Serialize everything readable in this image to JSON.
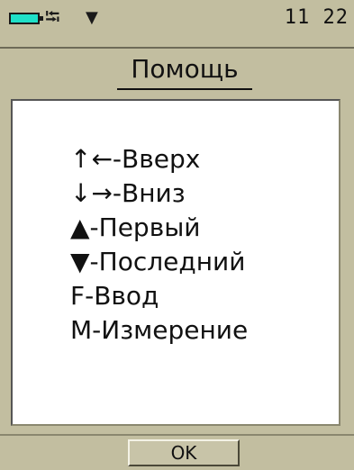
{
  "status_bar": {
    "battery_icon": "battery-icon",
    "battery_color": "#1fe0c8",
    "usb_icon": "usb-icon",
    "signal_icon": "signal-icon",
    "time": "11 22"
  },
  "title": "Помощь",
  "help": {
    "lines": [
      "↑←-Вверх",
      "↓→-Вниз",
      "▲-Первый",
      "▼-Последний",
      "F-Ввод",
      "M-Измерение"
    ]
  },
  "ok_button": "OK",
  "colors": {
    "background": "#c2bea0",
    "panel": "#ffffff"
  }
}
